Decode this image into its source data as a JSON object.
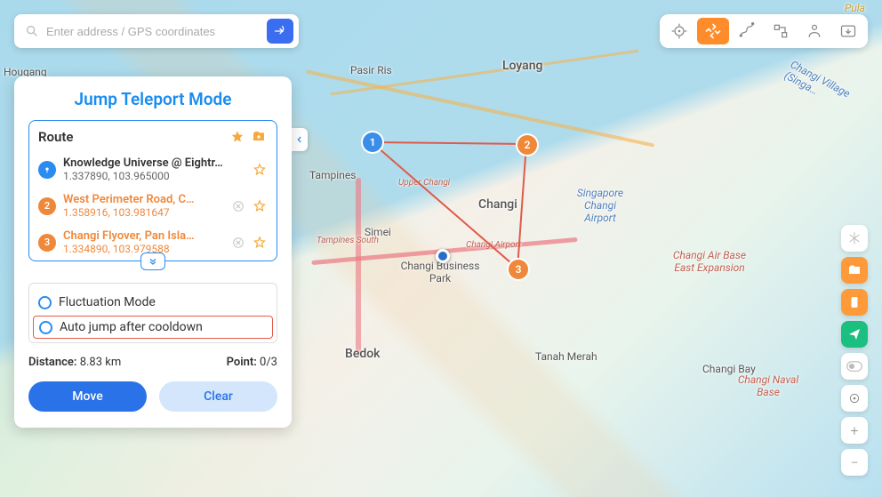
{
  "search": {
    "placeholder": "Enter address / GPS coordinates"
  },
  "panel": {
    "title": "Jump Teleport Mode",
    "route_label": "Route",
    "stops": [
      {
        "name": "Knowledge Universe @ Eightr…",
        "coords": "1.337890, 103.965000"
      },
      {
        "name": "West Perimeter Road, C…",
        "coords": "1.358916, 103.981647"
      },
      {
        "name": "Changi Flyover, Pan Isla…",
        "coords": "1.334890, 103.979588"
      }
    ],
    "opt_fluct": "Fluctuation Mode",
    "opt_auto": "Auto jump after cooldown",
    "distance_label": "Distance:",
    "distance_value": "8.83 km",
    "point_label": "Point:",
    "point_value": "0/3",
    "move": "Move",
    "clear": "Clear"
  },
  "map_labels": {
    "hougang": "Hougang",
    "pasir": "Pasir Ris",
    "tampines": "Tampines",
    "loyang": "Loyang",
    "changi": "Changi",
    "simei": "Simei",
    "bedok": "Bedok",
    "tanah": "Tanah Merah",
    "cbpark": "Changi Business Park",
    "uchangi": "Upper Changi",
    "tsouth": "Tampines South",
    "caport": "Changi Airport",
    "sgair": "Singapore Changi Airport",
    "cbay": "Changi Bay",
    "cabe": "Changi Air Base East Expansion",
    "cnb": "Changi Naval Base",
    "pula": "Pula",
    "cvillage": "Changi Village (Singa…"
  }
}
